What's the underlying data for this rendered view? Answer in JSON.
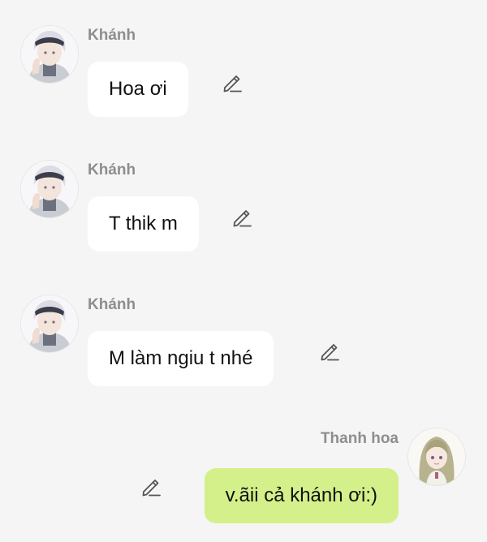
{
  "colors": {
    "page_background": "#f5f5f5",
    "incoming_bubble": "#ffffff",
    "outgoing_bubble": "#d4f08a",
    "sender_name": "#8e8e8e",
    "message_text": "#111111",
    "edit_icon": "#555555"
  },
  "messages": [
    {
      "sender": "Khánh",
      "text": "Hoa ơi",
      "direction": "incoming",
      "avatar": "avatar-khanh",
      "action_icon": "pencil-icon"
    },
    {
      "sender": "Khánh",
      "text": "T thik m",
      "direction": "incoming",
      "avatar": "avatar-khanh",
      "action_icon": "pencil-icon"
    },
    {
      "sender": "Khánh",
      "text": "M làm ngiu t nhé",
      "direction": "incoming",
      "avatar": "avatar-khanh",
      "action_icon": "pencil-icon"
    },
    {
      "sender": "Thanh hoa",
      "text": "v.ãii cả khánh ơi:)",
      "direction": "outgoing",
      "avatar": "avatar-thanh-hoa",
      "action_icon": "pencil-icon"
    }
  ]
}
